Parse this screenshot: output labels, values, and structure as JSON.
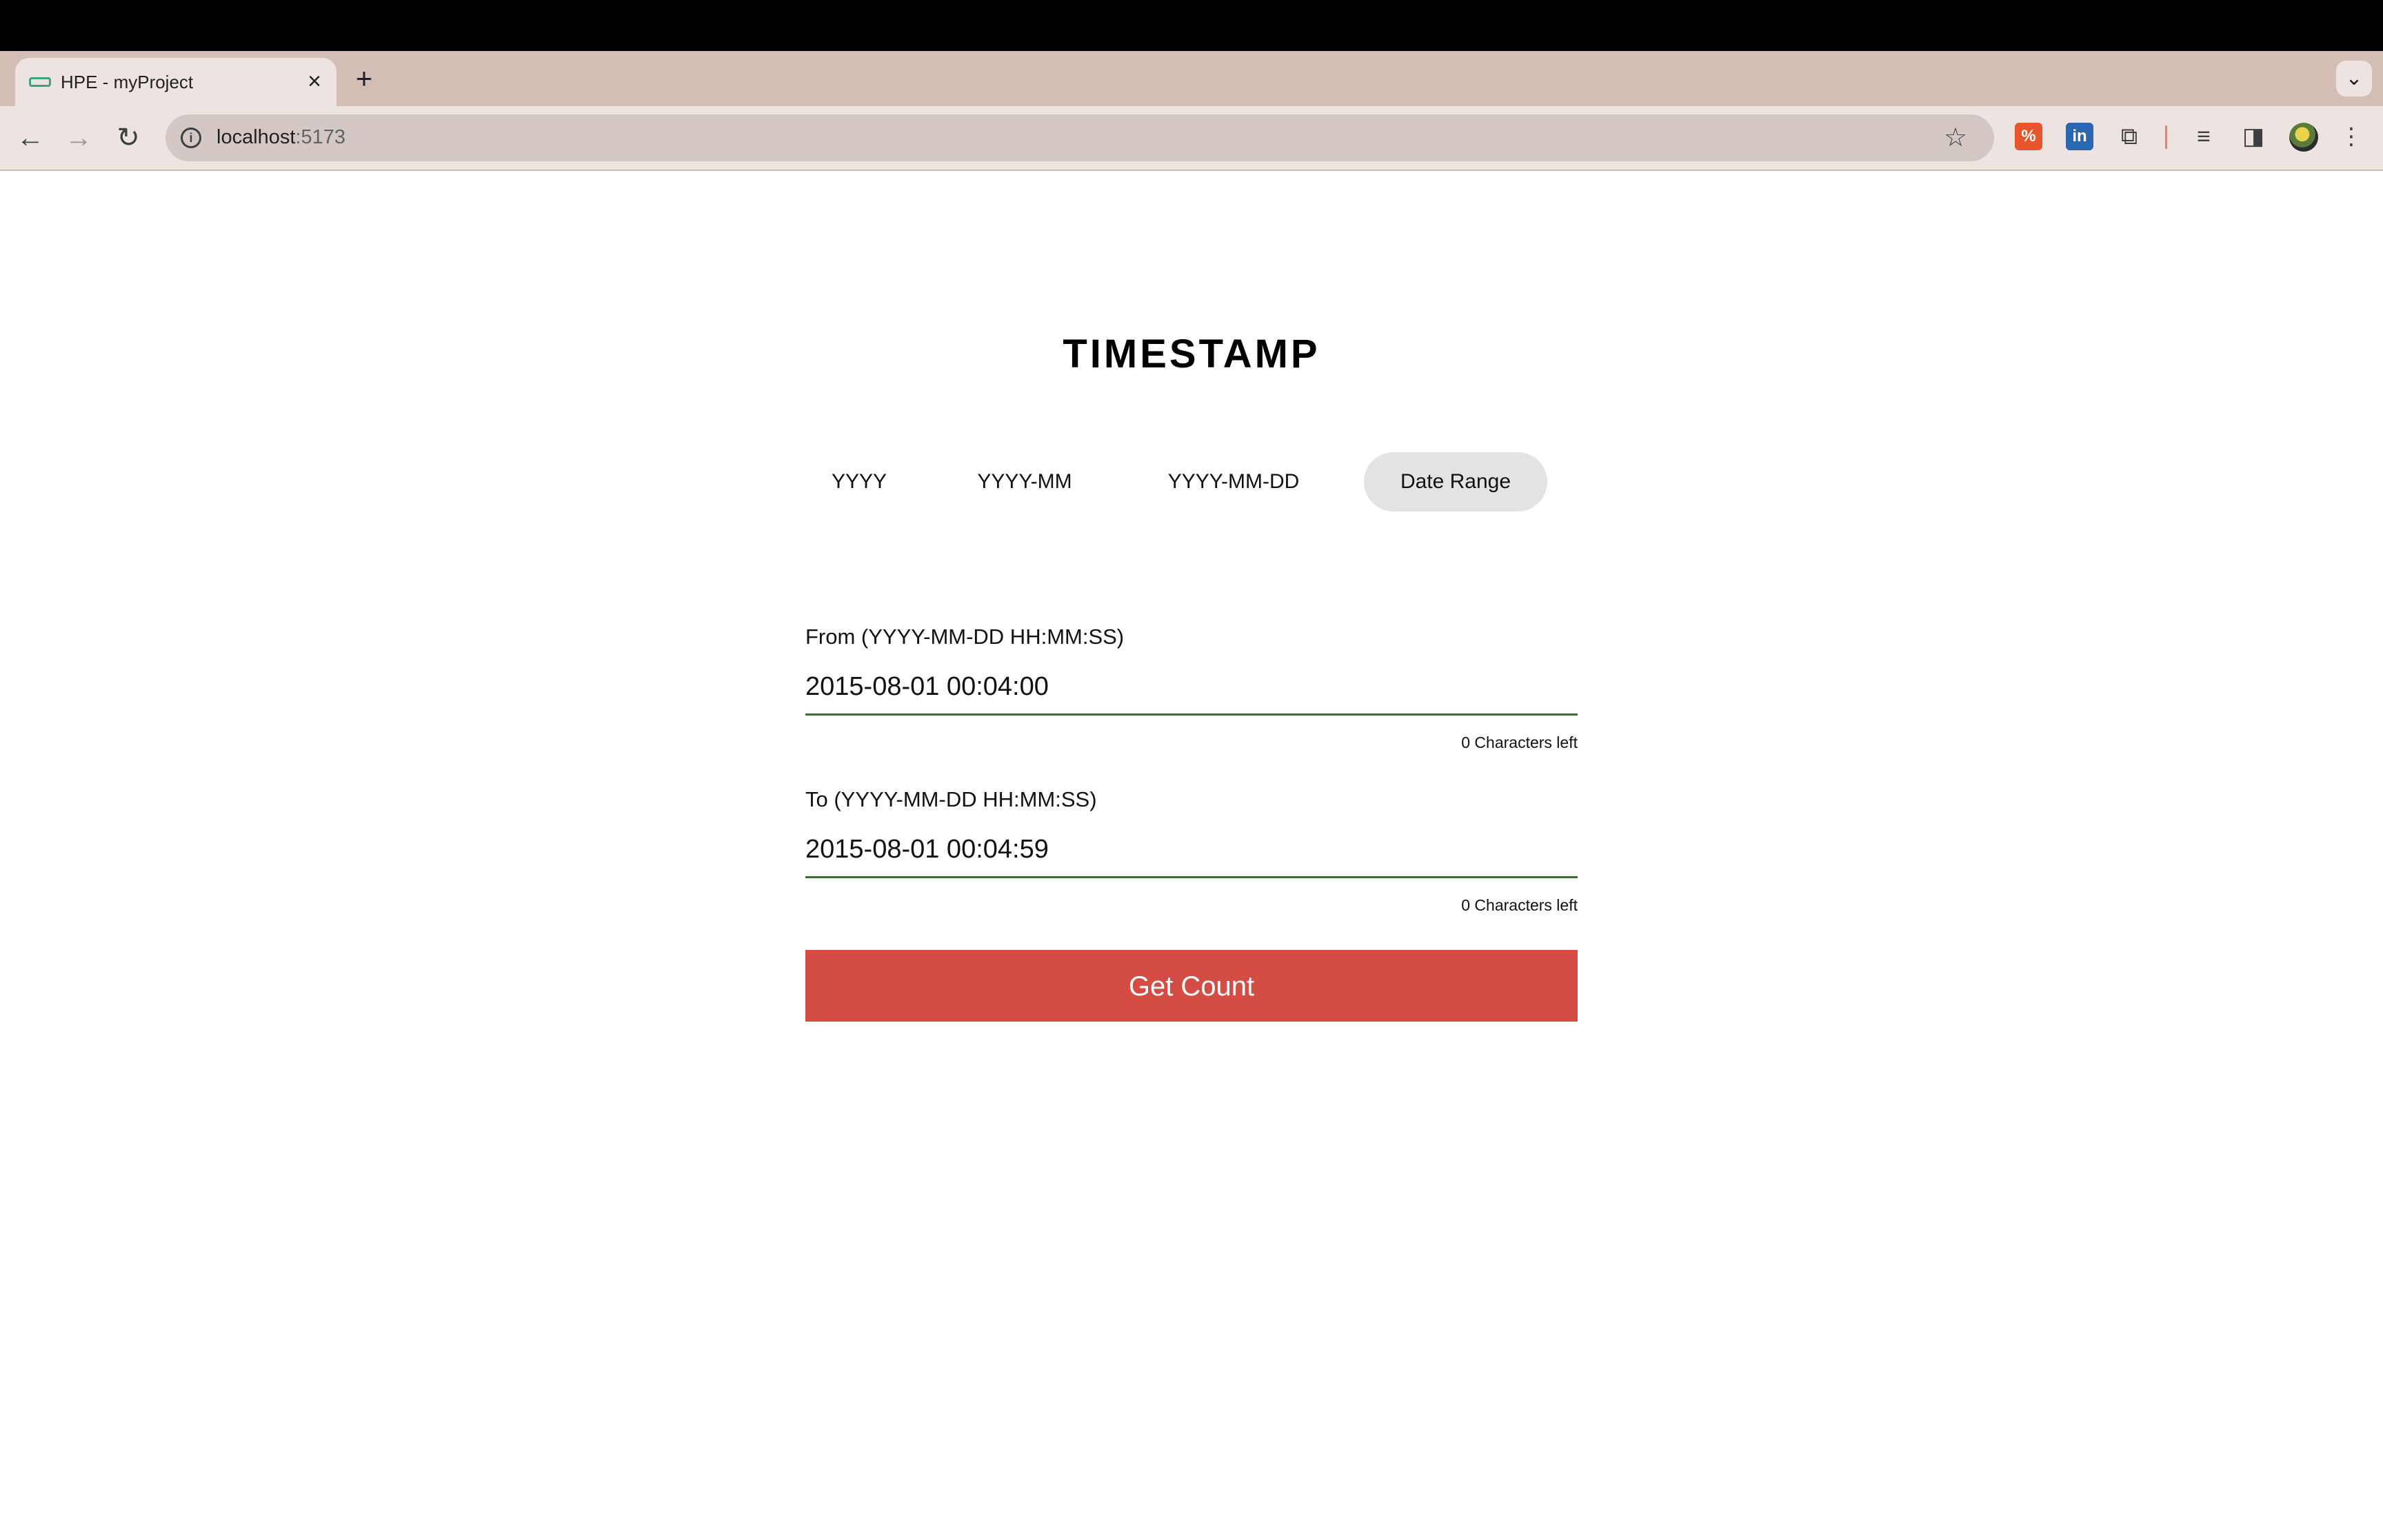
{
  "browser": {
    "tab_title": "HPE - myProject",
    "tab_close": "×",
    "new_tab": "+",
    "tab_search": "⌄",
    "url_host": "localhost",
    "url_port": ":5173",
    "back": "←",
    "forward": "→",
    "reload": "↻",
    "bookmark": "☆",
    "menu": "⋮",
    "icons": {
      "extension_1": "percent-extension-icon",
      "extension_2": "linkedin-icon",
      "extensions": "puzzle-icon",
      "media": "media-controls-icon",
      "side_panel": "side-panel-icon",
      "profile": "avatar"
    },
    "extension_2_label": "in"
  },
  "page": {
    "title": "TIMESTAMP",
    "mode_tabs": [
      {
        "label": "YYYY",
        "active": false
      },
      {
        "label": "YYYY-MM",
        "active": false
      },
      {
        "label": "YYYY-MM-DD",
        "active": false
      },
      {
        "label": "Date Range",
        "active": true
      }
    ],
    "from": {
      "label": "From (YYYY-MM-DD HH:MM:SS)",
      "value": "2015-08-01 00:04:00",
      "chars_left": "0 Characters left"
    },
    "to": {
      "label": "To (YYYY-MM-DD HH:MM:SS)",
      "value": "2015-08-01 00:04:59",
      "chars_left": "0 Characters left"
    },
    "submit_label": "Get Count"
  },
  "colors": {
    "accent_button": "#d44d44",
    "input_underline": "#2b7a1e",
    "active_tab_bg": "#e3e3e3",
    "browser_frame": "#d4bdb5"
  }
}
